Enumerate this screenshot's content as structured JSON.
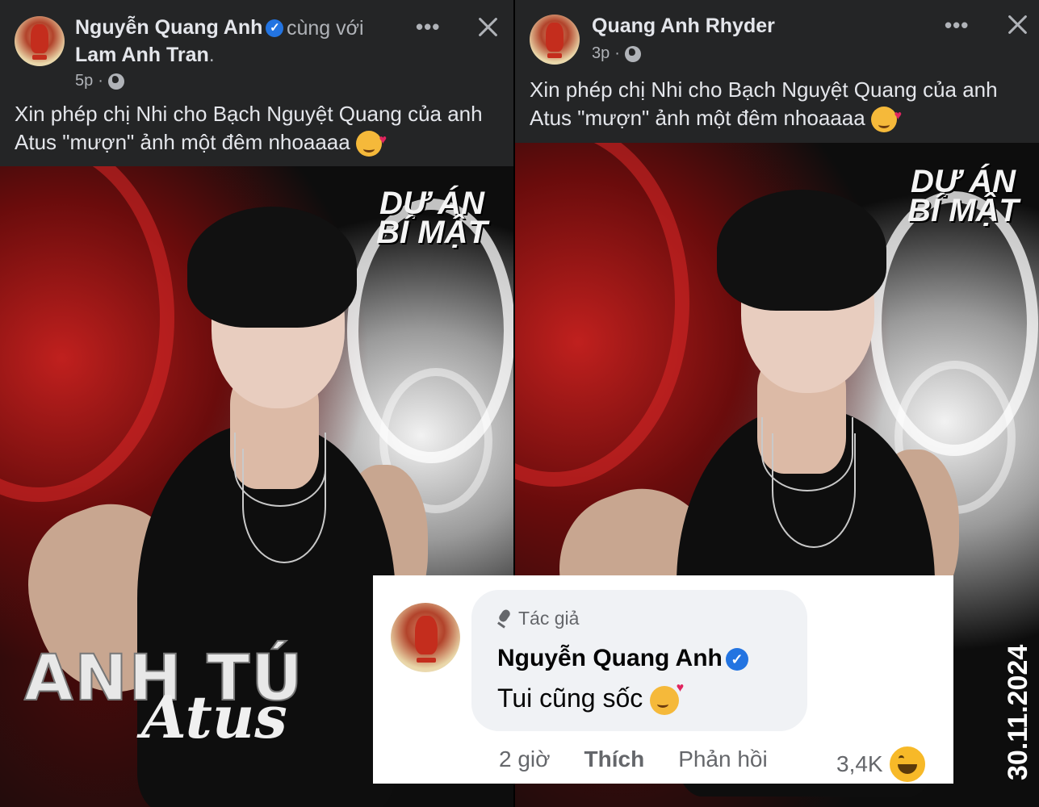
{
  "left_post": {
    "author": "Nguyễn Quang Anh",
    "with_text": "cùng với",
    "tagged": "Lam Anh Tran",
    "tagged_suffix": ".",
    "time": "5p",
    "more_icon": "more-dots-icon",
    "caption_line1": "Xin phép chị Nhi cho Bạch Nguyệt Quang của anh",
    "caption_line2": "Atus \"mượn\" ảnh một đêm nhoaaaa",
    "poster": {
      "logo_line1": "DỰ ÁN",
      "logo_line2": "BÍ MẬT",
      "title": "ANH TÚ",
      "title_script": "Atus"
    }
  },
  "right_post": {
    "author": "Quang Anh Rhyder",
    "time": "3p",
    "caption_line1": "Xin phép chị Nhi cho Bạch Nguyệt Quang của anh",
    "caption_line2": "Atus \"mượn\" ảnh một đêm nhoaaaa",
    "poster": {
      "logo_line1": "DỰ ÁN",
      "logo_line2": "BÍ MẬT",
      "date": "30.11.2024"
    }
  },
  "comment": {
    "role": "Tác giả",
    "author": "Nguyễn Quang Anh",
    "text": "Tui cũng sốc",
    "time": "2 giờ",
    "like_label": "Thích",
    "reply_label": "Phản hồi",
    "reaction_count": "3,4K"
  },
  "colors": {
    "background": "#242526",
    "text_primary": "#e4e6eb",
    "text_secondary": "#b0b3b8",
    "verified": "#2374e1"
  }
}
